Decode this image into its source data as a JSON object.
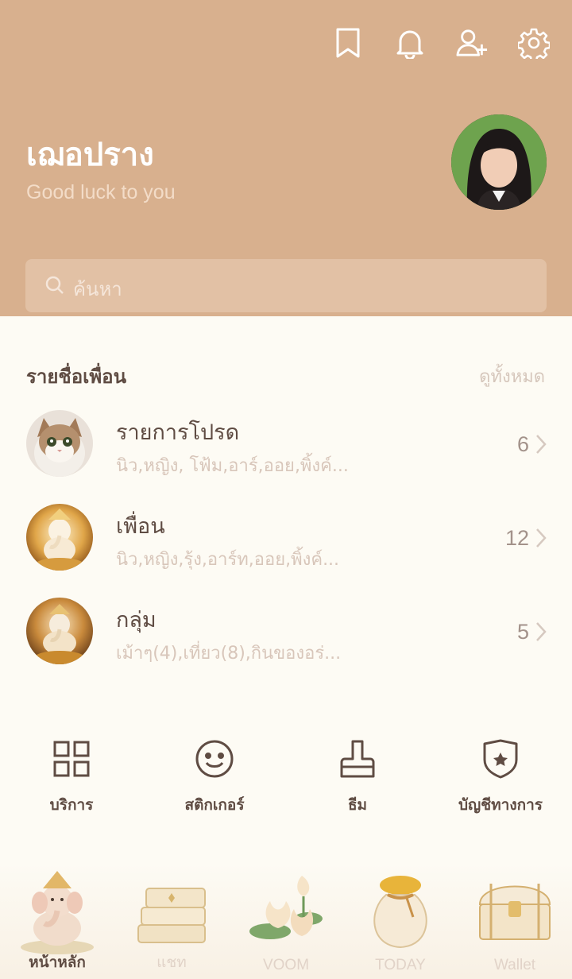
{
  "profile": {
    "name": "เฌอปราง",
    "status": "Good luck to you"
  },
  "header_icons": [
    "bookmark-icon",
    "bell-icon",
    "add-friend-icon",
    "gear-icon"
  ],
  "search": {
    "placeholder": "ค้นหา"
  },
  "friends_section": {
    "title": "รายชื่อเพื่อน",
    "see_all": "ดูทั้งหมด"
  },
  "lists": [
    {
      "title": "รายการโปรด",
      "subtitle": "นิว,หญิง, โฟ้ม,อาร์,ออย,พิ้งค์...",
      "count": "6"
    },
    {
      "title": "เพื่อน",
      "subtitle": "นิว,หญิง,รุ้ง,อาร์ท,ออย,พิ้งค์...",
      "count": "12"
    },
    {
      "title": "กลุ่ม",
      "subtitle": "เม้าๆ(4),เที่ยว(8),กินของอร่...",
      "count": "5"
    }
  ],
  "services": [
    {
      "label": "บริการ",
      "icon": "grid-icon"
    },
    {
      "label": "สติกเกอร์",
      "icon": "smiley-icon"
    },
    {
      "label": "ธีม",
      "icon": "brush-icon"
    },
    {
      "label": "บัญชีทางการ",
      "icon": "shield-star-icon"
    }
  ],
  "tabs": [
    {
      "label": "หน้าหลัก",
      "active": true
    },
    {
      "label": "แชท",
      "active": false
    },
    {
      "label": "VOOM",
      "active": false
    },
    {
      "label": "TODAY",
      "active": false
    },
    {
      "label": "Wallet",
      "active": false
    }
  ],
  "colors": {
    "header_bg": "#d8b08e",
    "text_dark": "#5f4c43",
    "page_bg": "#fdfbf4"
  }
}
